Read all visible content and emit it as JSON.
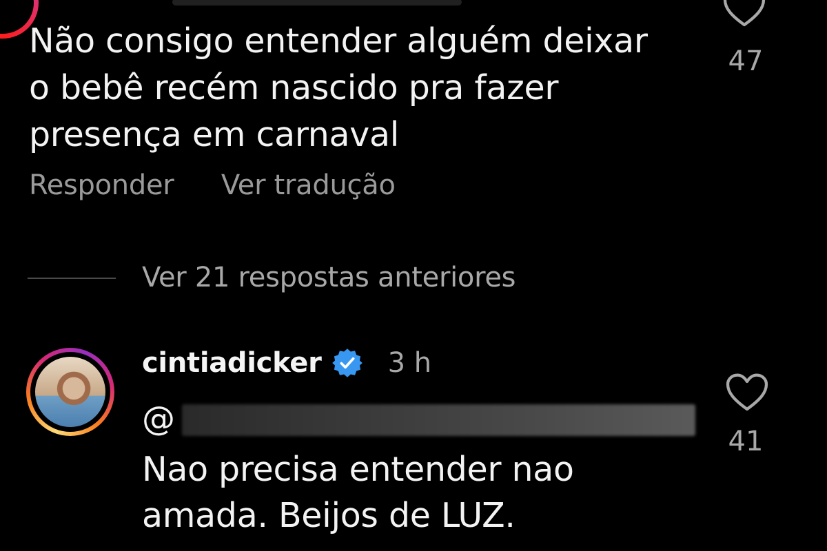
{
  "comment": {
    "text": "Não consigo entender alguém deixar\no bebê recém nascido pra fazer\npresença em carnaval",
    "likes": "47",
    "actions": {
      "reply_label": "Responder",
      "translate_label": "Ver tradução"
    }
  },
  "replies_toggle": {
    "label": "Ver 21 respostas anteriores"
  },
  "reply": {
    "username": "cintiadicker",
    "verified": true,
    "timestamp": "3 h",
    "mention_prefix": "@",
    "text": "Nao precisa entender nao\namada. Beijos de LUZ.",
    "likes": "41"
  },
  "icons": {
    "like": "heart-outline-icon",
    "verified": "verified-badge-icon"
  },
  "colors": {
    "background": "#000000",
    "primary_text": "#f3f3f3",
    "secondary_text": "#a8a8a8",
    "verified_blue": "#3897f0"
  }
}
